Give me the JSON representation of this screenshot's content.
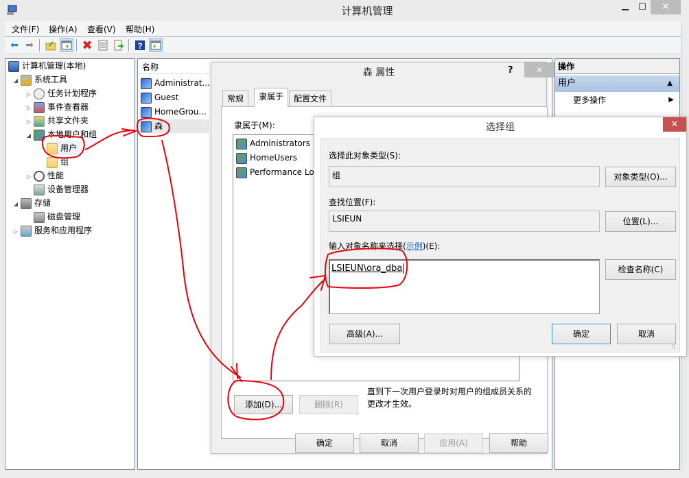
{
  "window": {
    "title": "计算机管理",
    "controls": {
      "minimize": "▁",
      "maximize": "☐",
      "close": "✕"
    }
  },
  "menu": [
    "文件(F)",
    "操作(A)",
    "查看(V)",
    "帮助(H)"
  ],
  "toolbar": {
    "icons": [
      "back-arrow",
      "forward-arrow",
      "up-folder",
      "show-hide-tree",
      "delete",
      "properties",
      "export-list",
      "help",
      "show-hide-action-pane"
    ],
    "glyphs": {
      "back": "⬅",
      "forward": "➡",
      "up": "📂",
      "tree": "▤",
      "delete": "✖",
      "properties": "▦",
      "export": "⇨",
      "help": "?",
      "action": "▥"
    }
  },
  "tree": {
    "items": [
      {
        "label": "计算机管理(本地)",
        "level": 0,
        "expander": ""
      },
      {
        "label": "系统工具",
        "level": 1,
        "expander": "◢"
      },
      {
        "label": "任务计划程序",
        "level": 2,
        "expander": "▷"
      },
      {
        "label": "事件查看器",
        "level": 2,
        "expander": "▷"
      },
      {
        "label": "共享文件夹",
        "level": 2,
        "expander": "▷"
      },
      {
        "label": "本地用户和组",
        "level": 2,
        "expander": "◢"
      },
      {
        "label": "用户",
        "level": 3,
        "expander": ""
      },
      {
        "label": "组",
        "level": 3,
        "expander": ""
      },
      {
        "label": "性能",
        "level": 2,
        "expander": "▷"
      },
      {
        "label": "设备管理器",
        "level": 2,
        "expander": ""
      },
      {
        "label": "存储",
        "level": 1,
        "expander": "◢"
      },
      {
        "label": "磁盘管理",
        "level": 2,
        "expander": ""
      },
      {
        "label": "服务和应用程序",
        "level": 1,
        "expander": "▷"
      }
    ]
  },
  "list": {
    "header": "名称",
    "rows": [
      "Administrat...",
      "Guest",
      "HomeGrou...",
      "森"
    ]
  },
  "actions": {
    "header": "操作",
    "section": "用户",
    "section_arrow": "▲",
    "more": "更多操作",
    "more_arrow": "▶"
  },
  "props_dialog": {
    "title": "森 属性",
    "help": "?",
    "close": "✕",
    "tabs": [
      "常规",
      "隶属于",
      "配置文件"
    ],
    "active_tab": "隶属于",
    "memberof_label": "隶属于(M):",
    "members": [
      "Administrators",
      "HomeUsers",
      "Performance Log Users"
    ],
    "add_button": "添加(D)...",
    "remove_button": "删除(R)",
    "note": "直到下一次用户登录时对用户的组成员关系的更改才生效。",
    "ok": "确定",
    "cancel": "取消",
    "apply": "应用(A)",
    "help_button": "帮助"
  },
  "select_group_dialog": {
    "title": "选择组",
    "close": "✕",
    "object_type_label": "选择此对象类型(S):",
    "object_type_value": "组",
    "object_type_button": "对象类型(O)...",
    "location_label": "查找位置(F):",
    "location_value": "LSIEUN",
    "location_button": "位置(L)...",
    "names_label_prefix": "输入对象名称来选择(",
    "names_label_link": "示例",
    "names_label_suffix": ")(E):",
    "names_value": "LSIEUN\\ora_dba",
    "check_names_button": "检查名称(C)",
    "advanced_button": "高级(A)...",
    "ok": "确定",
    "cancel": "取消"
  },
  "colors": {
    "annotation": "#e8000a",
    "link": "#2a6ac8",
    "close_red": "#c75050",
    "action_section": "#b4cce8"
  }
}
